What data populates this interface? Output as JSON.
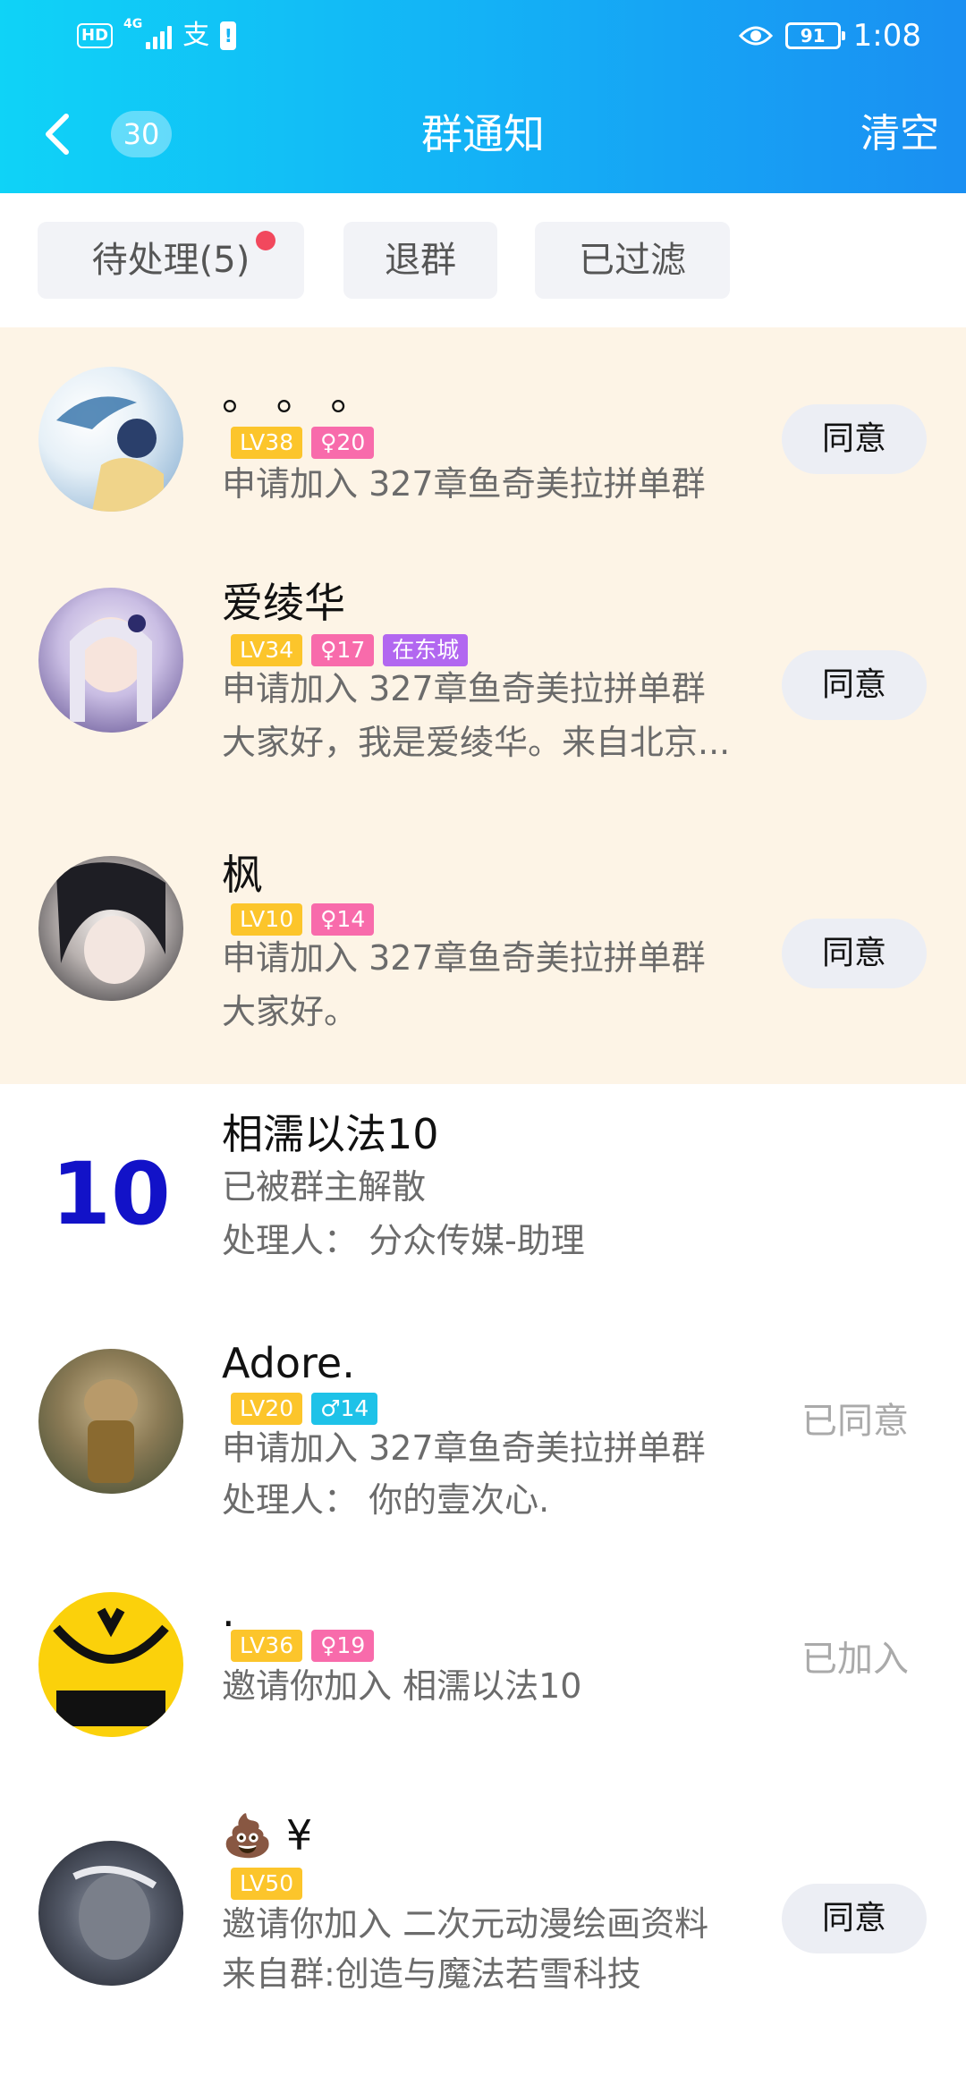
{
  "status_bar": {
    "hd": "HD",
    "network": "4G",
    "app_glyph": "支",
    "battery": "91",
    "time": "1:08",
    "icons": [
      "hd-icon",
      "signal-icon",
      "alipay-icon",
      "warning-icon",
      "eye-icon",
      "battery-icon"
    ]
  },
  "nav": {
    "back_icon": "chevron-left-icon",
    "badge": "30",
    "title": "群通知",
    "clear": "清空"
  },
  "filters": [
    {
      "label": "待处理(5)",
      "has_dot": true
    },
    {
      "label": "退群"
    },
    {
      "label": "已过滤"
    }
  ],
  "colors": {
    "header_start": "#0fd3f7",
    "header_end": "#1a8ff2",
    "highlight_bg": "#fdf4e6",
    "lv_tag": "#fcc52b",
    "female_tag": "#f86bab",
    "male_tag": "#1ec2e8",
    "location_tag": "#b267f0",
    "red_dot": "#f2485d"
  },
  "notices": [
    {
      "name": "。 。 。",
      "tags": [
        "LV38",
        "♀20"
      ],
      "lines": [
        "申请加入 327章鱼奇美拉拼单群"
      ],
      "action": "同意"
    },
    {
      "name": "爱绫华",
      "tags": [
        "LV34",
        "♀17",
        "在东城"
      ],
      "lines": [
        "申请加入 327章鱼奇美拉拼单群",
        "大家好，我是爱绫华。来自北京..."
      ],
      "action": "同意"
    },
    {
      "name": "枫",
      "tags": [
        "LV10",
        "♀14"
      ],
      "lines": [
        "申请加入 327章鱼奇美拉拼单群",
        "大家好。"
      ],
      "action": "同意"
    },
    {
      "name": "相濡以法10",
      "avatar_text": "10",
      "lines": [
        "已被群主解散",
        "处理人：  分众传媒-助理"
      ]
    },
    {
      "name": "Adore.",
      "tags": [
        "LV20",
        "♂14"
      ],
      "lines": [
        "申请加入 327章鱼奇美拉拼单群",
        "处理人：  你的壹次心."
      ],
      "status": "已同意"
    },
    {
      "name": ".",
      "tags": [
        "LV36",
        "♀19"
      ],
      "lines": [
        "邀请你加入 相濡以法10"
      ],
      "status": "已加入"
    },
    {
      "name": "💩 ¥",
      "tags": [
        "LV50"
      ],
      "lines": [
        "邀请你加入 二次元动漫绘画资料",
        "来自群:创造与魔法若雪科技"
      ],
      "action": "同意"
    }
  ]
}
